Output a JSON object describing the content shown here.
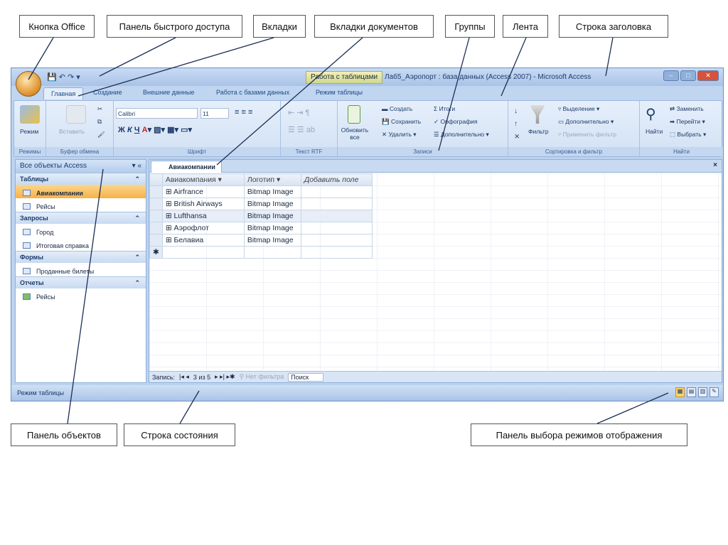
{
  "callouts_top": [
    "Кнопка Office",
    "Панель быстрого доступа",
    "Вкладки",
    "Вкладки документов",
    "Группы",
    "Лента",
    "Строка заголовка"
  ],
  "callouts_bottom": [
    "Панель объектов",
    "Строка состояния",
    "Панель выбора режимов отображения"
  ],
  "window": {
    "context_tab": "Работа с таблицами",
    "title": "Лаб5_Аэропорт : база данных (Access 2007) - Microsoft Access"
  },
  "tabs": [
    "Главная",
    "Создание",
    "Внешние данные",
    "Работа с базами данных",
    "Режим таблицы"
  ],
  "ribbon": {
    "groups": [
      "Режимы",
      "Буфер обмена",
      "Шрифт",
      "Текст RTF",
      "Записи",
      "Сортировка и фильтр",
      "Найти"
    ],
    "view_btn": "Режим",
    "paste_btn": "Вставить",
    "font_name": "Calibri",
    "font_size": "11",
    "refresh_btn": "Обновить все",
    "records": [
      "Создать",
      "Сохранить",
      "Удалить",
      "Итоги",
      "Орфография",
      "Дополнительно"
    ],
    "filter_btn": "Фильтр",
    "filter_items": [
      "Выделение",
      "Дополнительно",
      "Применить фильтр"
    ],
    "find_btn": "Найти",
    "find_items": [
      "Заменить",
      "Перейти",
      "Выбрать"
    ]
  },
  "nav": {
    "header": "Все объекты Access",
    "sections": [
      {
        "title": "Таблицы",
        "items": [
          "Авиакомпании",
          "Рейсы"
        ]
      },
      {
        "title": "Запросы",
        "items": [
          "Город",
          "Итоговая справка"
        ]
      },
      {
        "title": "Формы",
        "items": [
          "Проданные билеты"
        ]
      },
      {
        "title": "Отчеты",
        "items": [
          "Рейсы"
        ]
      }
    ]
  },
  "document": {
    "tab": "Авиакомпании",
    "columns": [
      "Авиакомпания",
      "Логотип",
      "Добавить поле"
    ],
    "rows": [
      [
        "Airfrance",
        "Bitmap Image"
      ],
      [
        "British Airways",
        "Bitmap Image"
      ],
      [
        "Lufthansa",
        "Bitmap Image"
      ],
      [
        "Аэрофлот",
        "Bitmap Image"
      ],
      [
        "Белавиа",
        "Bitmap Image"
      ]
    ]
  },
  "record_nav": {
    "label": "Запись:",
    "position": "3 из 5",
    "filter": "Нет фильтра",
    "search": "Поиск"
  },
  "status": {
    "text": "Режим таблицы"
  }
}
